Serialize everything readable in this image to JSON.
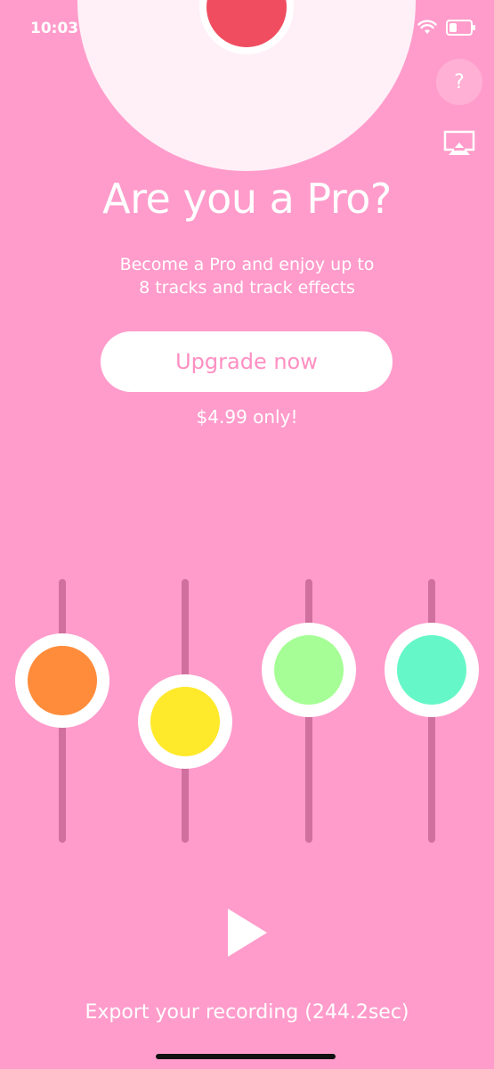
{
  "status_bar": {
    "time": "10:03",
    "battery_level": 0.3
  },
  "header": {
    "help_label": "?",
    "icons": [
      "help-icon",
      "airplay-icon"
    ]
  },
  "promo": {
    "title": "Are you a Pro?",
    "subtitle_line1": "Become a Pro and enjoy up to",
    "subtitle_line2": "8 tracks and track effects",
    "button_label": "Upgrade now",
    "price": "$4.99 only!"
  },
  "mixer": {
    "sliders": [
      {
        "color": "#ff8c3b",
        "level": 0.65
      },
      {
        "color": "#ffe92b",
        "level": 0.45
      },
      {
        "color": "#a6ff96",
        "level": 0.7
      },
      {
        "color": "#66f7c8",
        "level": 0.7
      }
    ]
  },
  "colors": {
    "background": "#ff9ccb",
    "record_core": "#f04e60",
    "button_text": "#ff8fc2"
  },
  "footer": {
    "export_label": "Export your recording (244.2sec)"
  }
}
